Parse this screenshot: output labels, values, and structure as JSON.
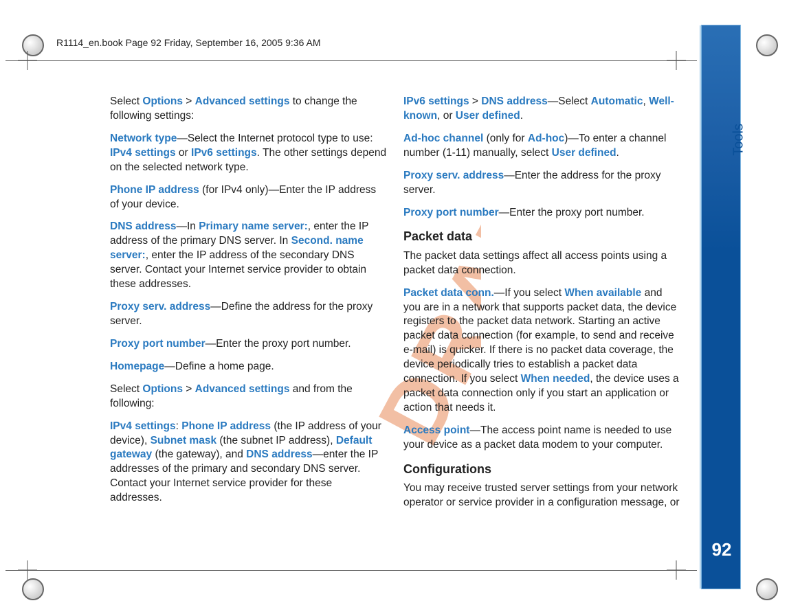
{
  "header": {
    "path": "R1114_en.book  Page 92  Friday, September 16, 2005  9:36 AM"
  },
  "side": {
    "tab": "Tools",
    "page": "92"
  },
  "watermark": "DRAFT",
  "left": {
    "p1a": "Select ",
    "p1b": "Options",
    "p1c": " > ",
    "p1d": "Advanced settings",
    "p1e": " to change the following settings:",
    "p2a": "Network type",
    "p2b": "—Select the Internet protocol type to use: ",
    "p2c": "IPv4 settings",
    "p2d": " or ",
    "p2e": "IPv6 settings",
    "p2f": ". The other settings depend on the selected network type.",
    "p3a": "Phone IP address",
    "p3b": " (for IPv4 only)—Enter the IP address of your device.",
    "p4a": "DNS address",
    "p4b": "—In ",
    "p4c": "Primary name server:",
    "p4d": ", enter the IP address of the primary DNS server. In ",
    "p4e": "Second. name server:",
    "p4f": ", enter the IP address of the secondary DNS server. Contact your Internet service provider to obtain these addresses.",
    "p5a": "Proxy serv. address",
    "p5b": "—Define the address for the proxy server.",
    "p6a": "Proxy port number",
    "p6b": "—Enter the proxy port number.",
    "p7a": "Homepage",
    "p7b": "—Define a home page.",
    "p8a": "Select ",
    "p8b": "Options",
    "p8c": " > ",
    "p8d": "Advanced settings",
    "p8e": " and from the following:",
    "p9a": "IPv4 settings",
    "p9b": ": ",
    "p9c": "Phone IP address",
    "p9d": " (the IP address of your device), ",
    "p9e": "Subnet mask",
    "p9f": " (the subnet IP address), ",
    "p9g": "Default gateway",
    "p9h": " (the gateway), and ",
    "p9i": "DNS address",
    "p9j": "—enter the IP addresses of the primary and secondary DNS server. Contact your Internet service provider for these addresses."
  },
  "right": {
    "r1a": "IPv6 settings",
    "r1b": " > ",
    "r1c": "DNS address",
    "r1d": "—Select ",
    "r1e": "Automatic",
    "r1f": ", ",
    "r1g": "Well-known",
    "r1h": ", or ",
    "r1i": "User defined",
    "r1j": ".",
    "r2a": "Ad-hoc channel",
    "r2b": " (only for ",
    "r2c": "Ad-hoc",
    "r2d": ")—To enter a channel number (1-11) manually, select ",
    "r2e": "User defined",
    "r2f": ".",
    "r3a": "Proxy serv. address",
    "r3b": "—Enter the address for the proxy server.",
    "r4a": "Proxy port number",
    "r4b": "—Enter the proxy port number.",
    "h1": "Packet data",
    "r5": "The packet data settings affect all access points using a packet data connection.",
    "r6a": "Packet data conn.",
    "r6b": "—If you select ",
    "r6c": "When available",
    "r6d": " and you are in a network that supports packet data, the device registers to the packet data network. Starting an active packet data connection (for example, to send and receive e-mail) is quicker. If there is no packet data coverage, the device periodically tries to establish a packet data connection. If you select ",
    "r6e": "When needed",
    "r6f": ", the device uses a packet data connection only if you start an application or action that needs it.",
    "r7a": "Access point",
    "r7b": "—The access point name is needed to use your device as a packet data modem to your computer.",
    "h2": "Configurations",
    "r8": "You may receive trusted server settings from your network operator or service provider in a configuration message, or"
  }
}
